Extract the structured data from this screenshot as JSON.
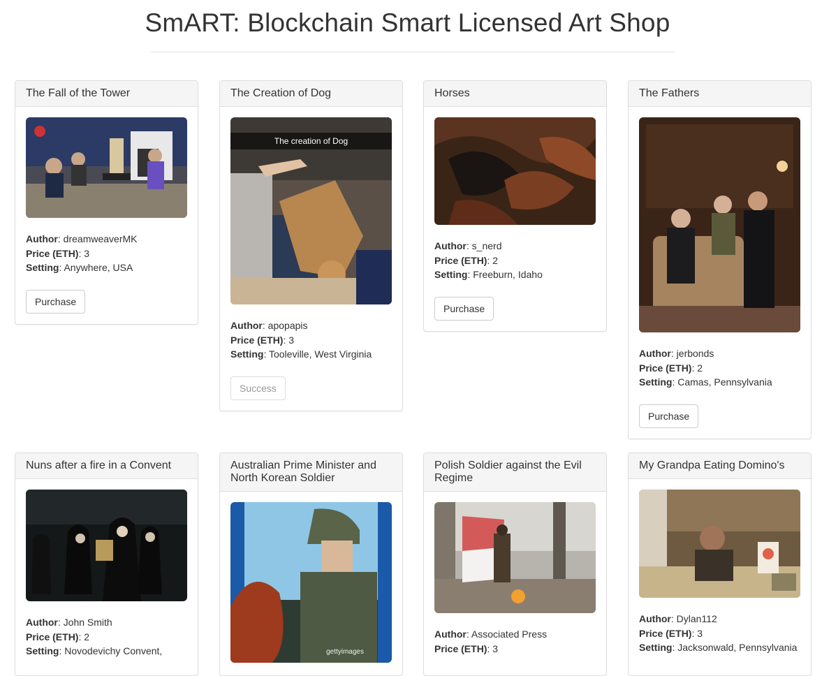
{
  "page": {
    "title": "SmART: Blockchain Smart Licensed Art Shop"
  },
  "labels": {
    "author": "Author",
    "price": "Price (ETH)",
    "setting": "Setting"
  },
  "cards": [
    {
      "title": "The Fall of the Tower",
      "author": "dreamweaverMK",
      "price": "3",
      "setting": "Anywhere, USA",
      "button": "Purchase"
    },
    {
      "title": "The Creation of Dog",
      "image_caption": "The creation of Dog",
      "author": "apopapis",
      "price": "3",
      "setting": "Tooleville, West Virginia",
      "button": "Success"
    },
    {
      "title": "Horses",
      "author": "s_nerd",
      "price": "2",
      "setting": "Freeburn, Idaho",
      "button": "Purchase"
    },
    {
      "title": "The Fathers",
      "author": "jerbonds",
      "price": "2",
      "setting": "Camas, Pennsylvania",
      "button": "Purchase"
    },
    {
      "title": "Nuns after a fire in a Convent",
      "author": "John Smith",
      "price": "2",
      "setting": "Novodevichy Convent,"
    },
    {
      "title": "Australian Prime Minister and North Korean Soldier",
      "image_watermark": "gettyimages"
    },
    {
      "title": "Polish Soldier against the Evil Regime",
      "author": "Associated Press",
      "price": "3"
    },
    {
      "title": "My Grandpa Eating Domino's",
      "author": "Dylan112",
      "price": "3",
      "setting": "Jacksonwald, Pennsylvania"
    }
  ]
}
